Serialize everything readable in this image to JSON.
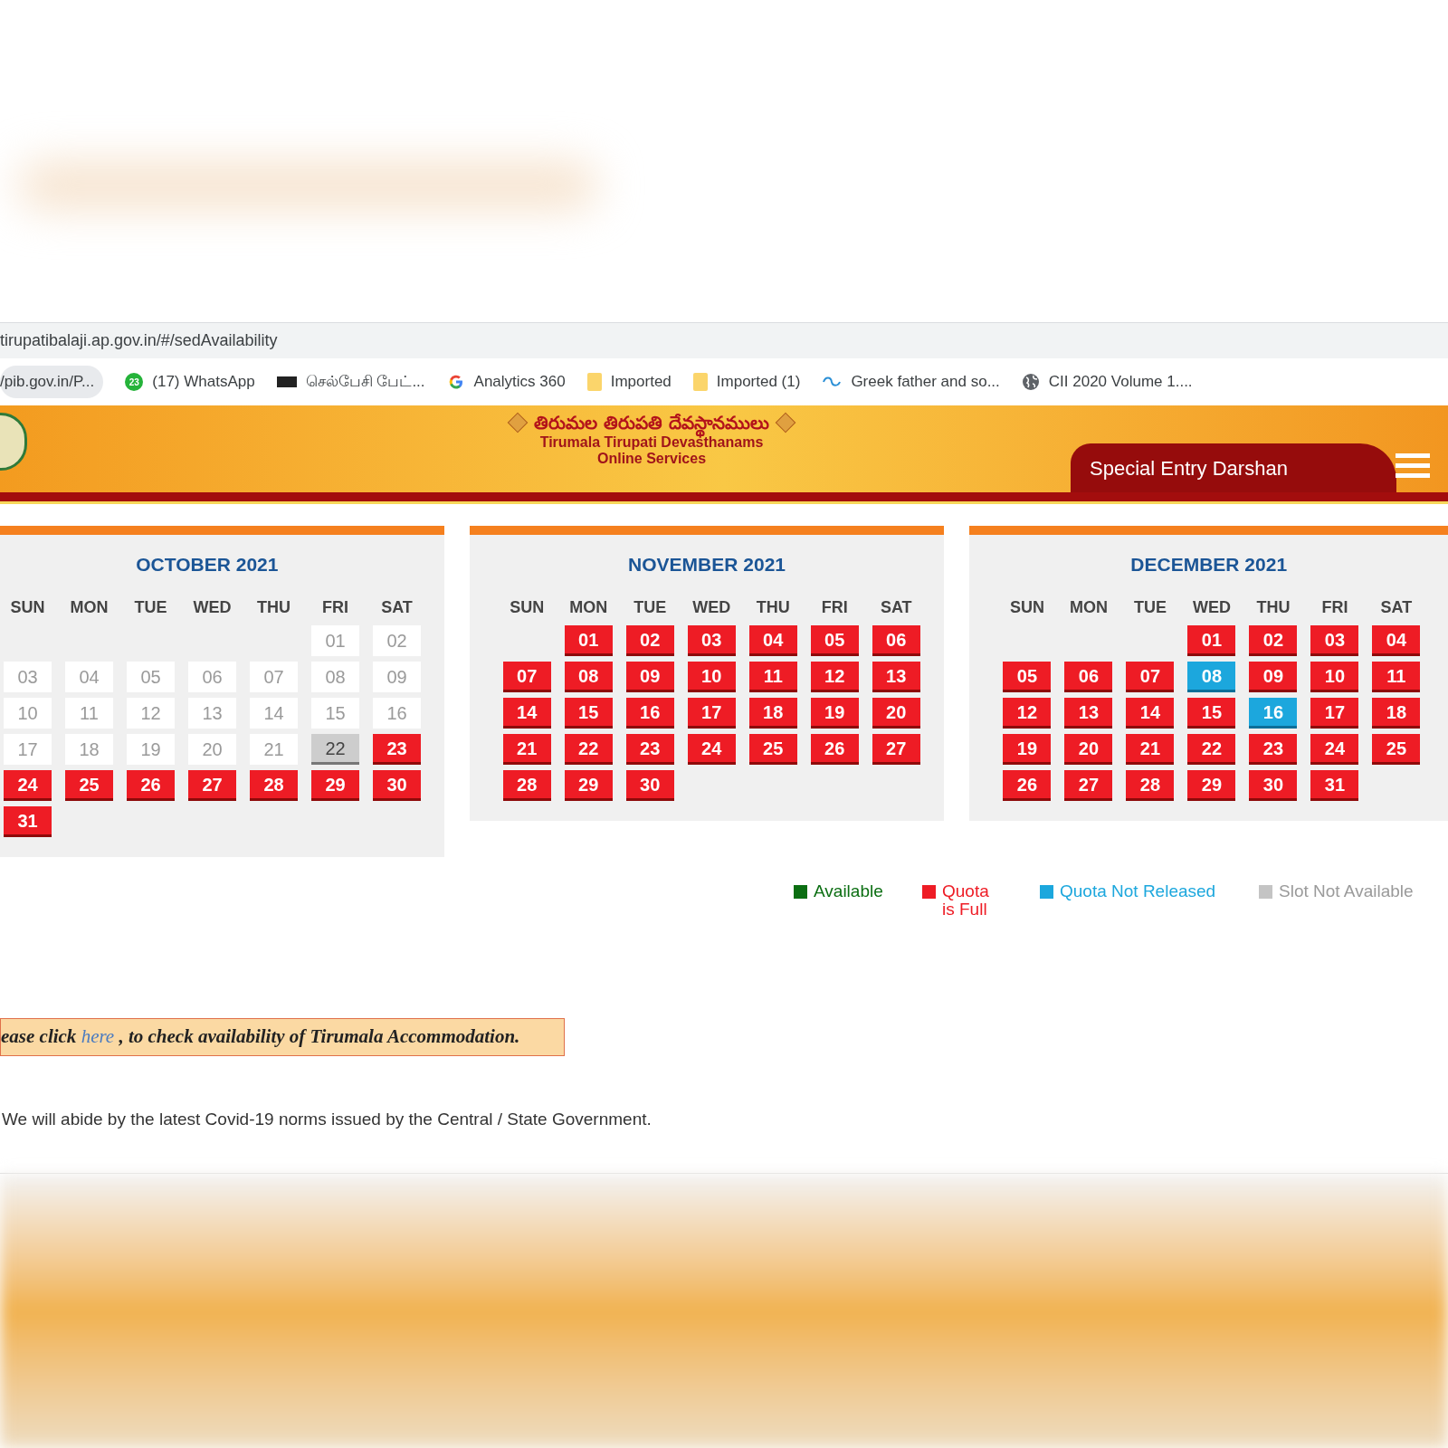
{
  "address_bar": {
    "url": "tirupatibalaji.ap.gov.in/#/sedAvailability"
  },
  "bookmarks": [
    {
      "kind": "plain",
      "label": "/pib.gov.in/P..."
    },
    {
      "kind": "chat",
      "badge": "23",
      "label": "(17) WhatsApp"
    },
    {
      "kind": "news",
      "label": "செல்பேசி பேட்..."
    },
    {
      "kind": "search",
      "label": "Analytics 360"
    },
    {
      "kind": "folder",
      "label": "Imported"
    },
    {
      "kind": "folder",
      "label": "Imported (1)"
    },
    {
      "kind": "swirl",
      "label": "Greek father and so..."
    },
    {
      "kind": "globe",
      "label": "CII 2020 Volume 1...."
    }
  ],
  "header": {
    "logo_text": "తిరుమల తిరుపతి దేవస్థానములు",
    "org_name": "Tirumala Tirupati Devasthanams",
    "subtitle": "Online Services",
    "page_title": "Special Entry Darshan"
  },
  "months": [
    {
      "title": "OCTOBER 2021",
      "weekdays": [
        "SUN",
        "MON",
        "TUE",
        "WED",
        "THU",
        "FRI",
        "SAT"
      ],
      "weeks": [
        [
          {
            "kind": "blank"
          },
          {
            "kind": "blank"
          },
          {
            "kind": "blank"
          },
          {
            "kind": "blank"
          },
          {
            "kind": "blank"
          },
          {
            "day": "01",
            "kind": "past"
          },
          {
            "day": "02",
            "kind": "past"
          }
        ],
        [
          {
            "day": "03",
            "kind": "past"
          },
          {
            "day": "04",
            "kind": "past"
          },
          {
            "day": "05",
            "kind": "past"
          },
          {
            "day": "06",
            "kind": "past"
          },
          {
            "day": "07",
            "kind": "past"
          },
          {
            "day": "08",
            "kind": "past"
          },
          {
            "day": "09",
            "kind": "past"
          }
        ],
        [
          {
            "day": "10",
            "kind": "past"
          },
          {
            "day": "11",
            "kind": "past"
          },
          {
            "day": "12",
            "kind": "past"
          },
          {
            "day": "13",
            "kind": "past"
          },
          {
            "day": "14",
            "kind": "past"
          },
          {
            "day": "15",
            "kind": "past"
          },
          {
            "day": "16",
            "kind": "past"
          }
        ],
        [
          {
            "day": "17",
            "kind": "past"
          },
          {
            "day": "18",
            "kind": "past"
          },
          {
            "day": "19",
            "kind": "past"
          },
          {
            "day": "20",
            "kind": "past"
          },
          {
            "day": "21",
            "kind": "past"
          },
          {
            "day": "22",
            "kind": "unavailable"
          },
          {
            "day": "23",
            "kind": "full"
          }
        ],
        [
          {
            "day": "24",
            "kind": "full"
          },
          {
            "day": "25",
            "kind": "full"
          },
          {
            "day": "26",
            "kind": "full"
          },
          {
            "day": "27",
            "kind": "full"
          },
          {
            "day": "28",
            "kind": "full"
          },
          {
            "day": "29",
            "kind": "full"
          },
          {
            "day": "30",
            "kind": "full"
          }
        ],
        [
          {
            "day": "31",
            "kind": "full"
          }
        ]
      ]
    },
    {
      "title": "NOVEMBER 2021",
      "weekdays": [
        "SUN",
        "MON",
        "TUE",
        "WED",
        "THU",
        "FRI",
        "SAT"
      ],
      "weeks": [
        [
          {
            "kind": "blank"
          },
          {
            "day": "01",
            "kind": "full"
          },
          {
            "day": "02",
            "kind": "full"
          },
          {
            "day": "03",
            "kind": "full"
          },
          {
            "day": "04",
            "kind": "full"
          },
          {
            "day": "05",
            "kind": "full"
          },
          {
            "day": "06",
            "kind": "full"
          }
        ],
        [
          {
            "day": "07",
            "kind": "full"
          },
          {
            "day": "08",
            "kind": "full"
          },
          {
            "day": "09",
            "kind": "full"
          },
          {
            "day": "10",
            "kind": "full"
          },
          {
            "day": "11",
            "kind": "full"
          },
          {
            "day": "12",
            "kind": "full"
          },
          {
            "day": "13",
            "kind": "full"
          }
        ],
        [
          {
            "day": "14",
            "kind": "full"
          },
          {
            "day": "15",
            "kind": "full"
          },
          {
            "day": "16",
            "kind": "full"
          },
          {
            "day": "17",
            "kind": "full"
          },
          {
            "day": "18",
            "kind": "full"
          },
          {
            "day": "19",
            "kind": "full"
          },
          {
            "day": "20",
            "kind": "full"
          }
        ],
        [
          {
            "day": "21",
            "kind": "full"
          },
          {
            "day": "22",
            "kind": "full"
          },
          {
            "day": "23",
            "kind": "full"
          },
          {
            "day": "24",
            "kind": "full"
          },
          {
            "day": "25",
            "kind": "full"
          },
          {
            "day": "26",
            "kind": "full"
          },
          {
            "day": "27",
            "kind": "full"
          }
        ],
        [
          {
            "day": "28",
            "kind": "full"
          },
          {
            "day": "29",
            "kind": "full"
          },
          {
            "day": "30",
            "kind": "full"
          }
        ]
      ]
    },
    {
      "title": "DECEMBER 2021",
      "weekdays": [
        "SUN",
        "MON",
        "TUE",
        "WED",
        "THU",
        "FRI",
        "SAT"
      ],
      "weeks": [
        [
          {
            "kind": "blank"
          },
          {
            "kind": "blank"
          },
          {
            "kind": "blank"
          },
          {
            "day": "01",
            "kind": "full"
          },
          {
            "day": "02",
            "kind": "full"
          },
          {
            "day": "03",
            "kind": "full"
          },
          {
            "day": "04",
            "kind": "full"
          }
        ],
        [
          {
            "day": "05",
            "kind": "full"
          },
          {
            "day": "06",
            "kind": "full"
          },
          {
            "day": "07",
            "kind": "full"
          },
          {
            "day": "08",
            "kind": "not_released"
          },
          {
            "day": "09",
            "kind": "full"
          },
          {
            "day": "10",
            "kind": "full"
          },
          {
            "day": "11",
            "kind": "full"
          }
        ],
        [
          {
            "day": "12",
            "kind": "full"
          },
          {
            "day": "13",
            "kind": "full"
          },
          {
            "day": "14",
            "kind": "full"
          },
          {
            "day": "15",
            "kind": "full"
          },
          {
            "day": "16",
            "kind": "not_released"
          },
          {
            "day": "17",
            "kind": "full"
          },
          {
            "day": "18",
            "kind": "full"
          }
        ],
        [
          {
            "day": "19",
            "kind": "full"
          },
          {
            "day": "20",
            "kind": "full"
          },
          {
            "day": "21",
            "kind": "full"
          },
          {
            "day": "22",
            "kind": "full"
          },
          {
            "day": "23",
            "kind": "full"
          },
          {
            "day": "24",
            "kind": "full"
          },
          {
            "day": "25",
            "kind": "full"
          }
        ],
        [
          {
            "day": "26",
            "kind": "full"
          },
          {
            "day": "27",
            "kind": "full"
          },
          {
            "day": "28",
            "kind": "full"
          },
          {
            "day": "29",
            "kind": "full"
          },
          {
            "day": "30",
            "kind": "full"
          },
          {
            "day": "31",
            "kind": "full"
          }
        ]
      ]
    }
  ],
  "legend": [
    {
      "label": "Available",
      "color": "#0b6e12"
    },
    {
      "label": "Quota is Full",
      "color": "#ee1c25"
    },
    {
      "label": "Quota Not Released",
      "color": "#1ca7dd"
    },
    {
      "label": "Slot Not Available",
      "color": "#c4c4c4"
    }
  ],
  "notice": {
    "before": "ease click ",
    "link": "here",
    "after": " , to check availability of Tirumala Accommodation."
  },
  "covid_note": "We will abide by the latest Covid-19 norms issued by the Central / State Government."
}
